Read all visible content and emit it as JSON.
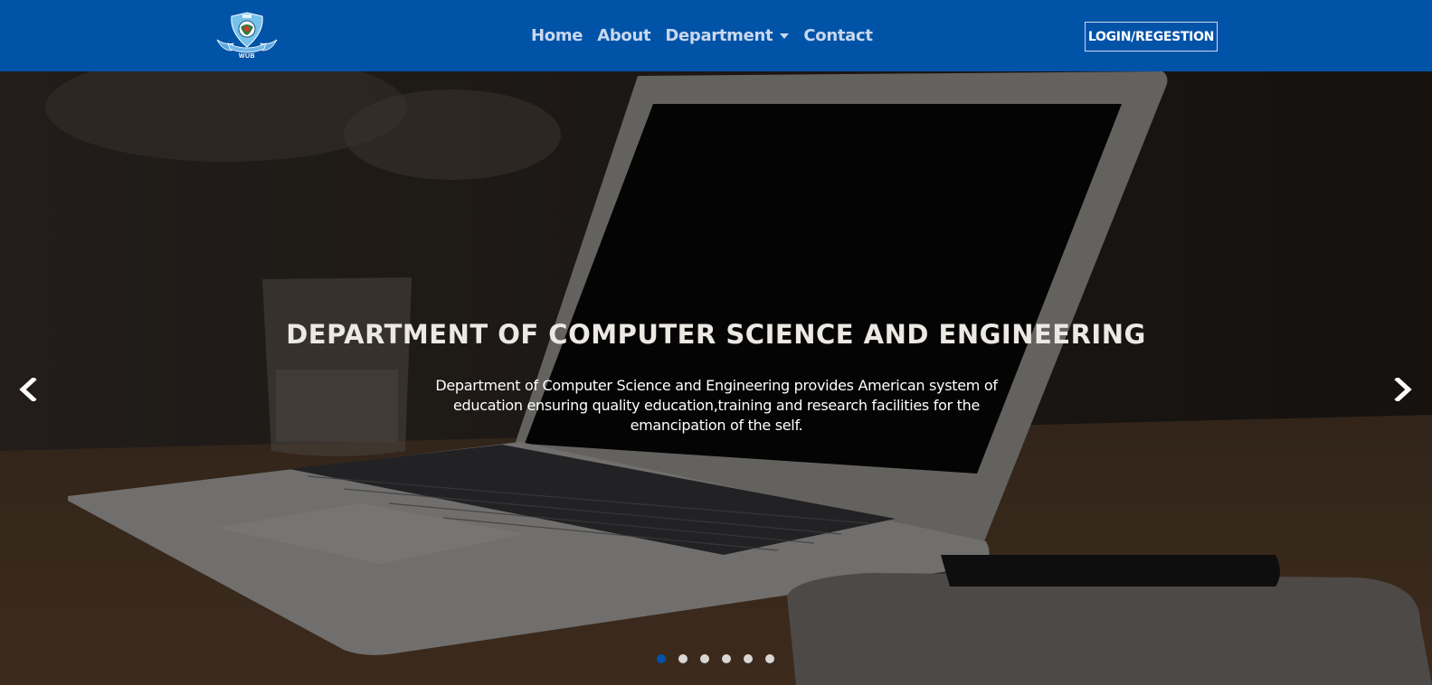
{
  "navbar": {
    "logo_text": "WUB",
    "links": [
      {
        "label": "Home"
      },
      {
        "label": "About"
      },
      {
        "label": "Department"
      },
      {
        "label": "Contact"
      }
    ],
    "login_label": "LOGIN/REGESTION"
  },
  "hero": {
    "title": "DEPARTMENT OF COMPUTER SCIENCE AND ENGINEERING",
    "description": "Department of Computer Science and Engineering provides American system of education ensuring quality education,training and research facilities for the emancipation of the self.",
    "slide_count": 6,
    "active_slide": 1
  },
  "colors": {
    "navbar_bg": "#0153a8",
    "active_indicator": "#0153a8"
  }
}
